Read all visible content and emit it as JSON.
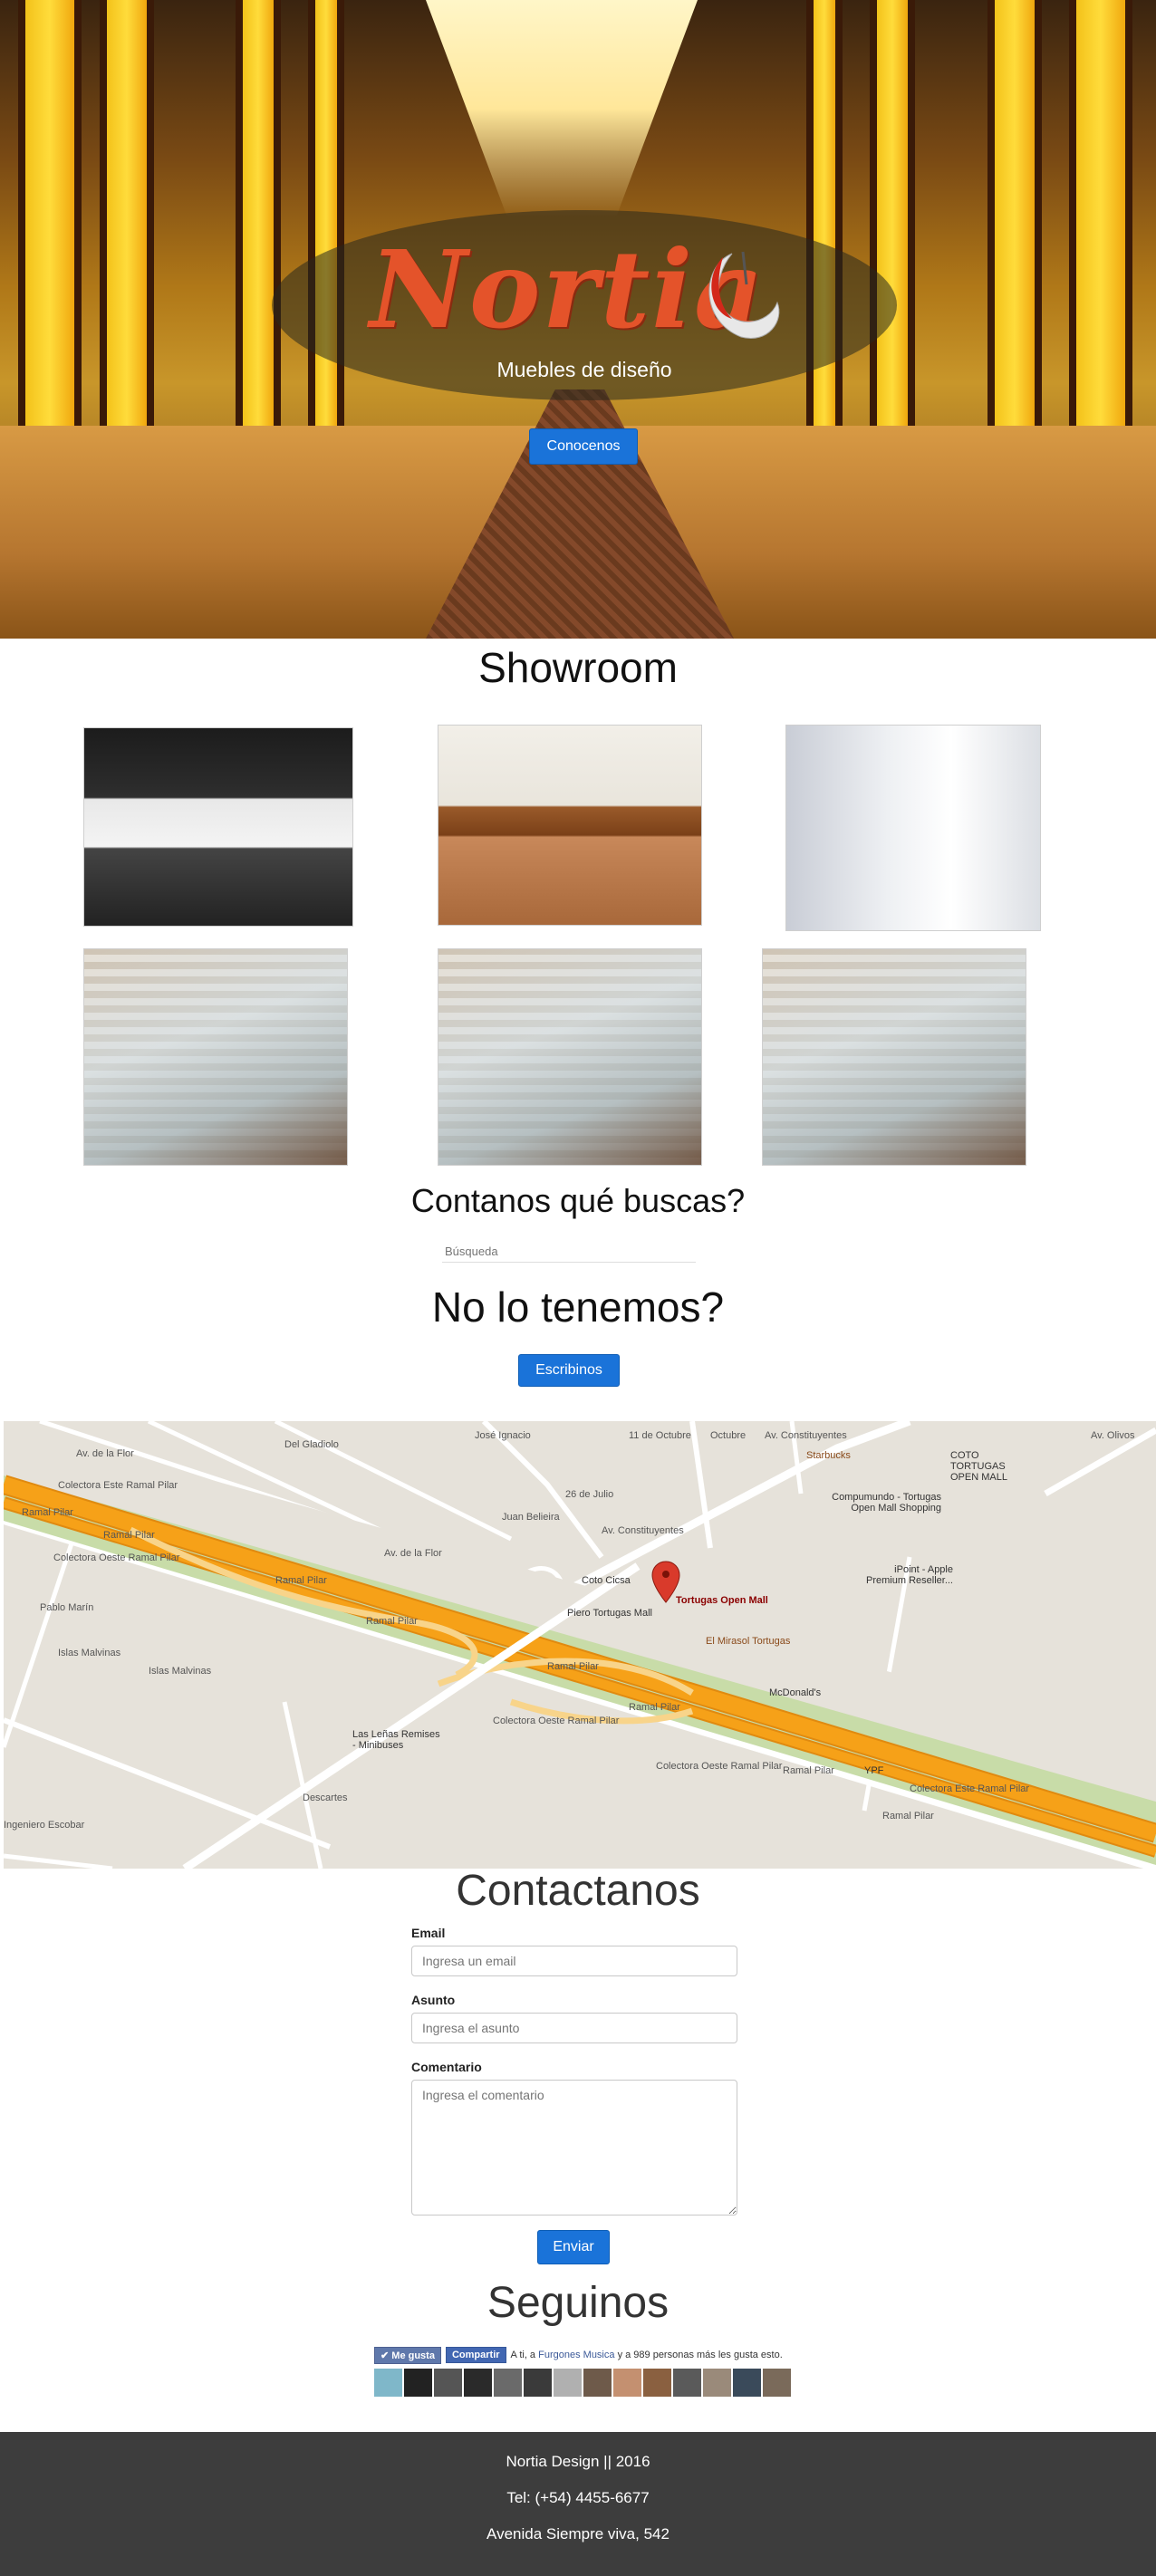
{
  "hero": {
    "brand": "Nortia",
    "tagline": "Muebles de diseño",
    "cta_label": "Conocenos"
  },
  "showroom": {
    "title": "Showroom",
    "photos": [
      "sala-moderna",
      "mesa-consola",
      "escritorio-blanco",
      "comedor-vidrio",
      "comedor-vidrio",
      "comedor-vidrio"
    ]
  },
  "search": {
    "title": "Contanos qué buscas?",
    "placeholder": "Búsqueda"
  },
  "not_found": {
    "title": "No lo tenemos?",
    "button_label": "Escribinos"
  },
  "map": {
    "marker_label": "Tortugas Open Mall",
    "labels": {
      "ramal_pilar": "Ramal Pilar",
      "colectora_este": "Colectora Este Ramal Pilar",
      "colectora_oeste": "Colectora Oeste Ramal Pilar",
      "av_flor": "Av. de la Flor",
      "del_gladiolo": "Del Gladiolo",
      "jose_ignacio": "José Ignacio",
      "once_octubre": "11 de Octubre",
      "octubre": "Octubre",
      "av_constituyentes": "Av. Constituyentes",
      "julio": "26 de Julio",
      "juan_belieira": "Juan Belieira",
      "islas_malvinas": "Islas Malvinas",
      "pablo_marin": "Pablo Marín",
      "descartes": "Descartes",
      "escobar": "Ingeniero Escobar",
      "av_olivos": "Av. Olivos",
      "starbucks": "Starbucks",
      "coto": "COTO TORTUGAS OPEN MALL",
      "compumundo": "Compumundo - Tortugas Open Mall Shopping",
      "ipoint": "iPoint - Apple Premium Reseller...",
      "coto_cicsa": "Coto Cicsa",
      "piero": "Piero Tortugas Mall",
      "mirasol": "El Mirasol Tortugas",
      "mcdonalds": "McDonald's",
      "ypf": "YPF",
      "las_lenas": "Las Leñas Remises - Minibuses"
    },
    "colors": {
      "highway": "#f6a118",
      "highway_border": "#e08a10",
      "green": "#c8dca8",
      "marker": "#d93a2b"
    }
  },
  "contact": {
    "title": "Contactanos",
    "email_label": "Email",
    "email_placeholder": "Ingresa un email",
    "subject_label": "Asunto",
    "subject_placeholder": "Ingresa el asunto",
    "comment_label": "Comentario",
    "comment_placeholder": "Ingresa el comentario",
    "submit_label": "Enviar"
  },
  "social": {
    "title": "Seguinos",
    "like_label": "Me gusta",
    "share_label": "Compartir",
    "text_pre": "A ti, a",
    "page_link": "Furgones Musica",
    "text_post": "y a 989 personas más les gusta esto.",
    "face_colors": [
      "#7fb7c9",
      "#222222",
      "#555555",
      "#2a2a2a",
      "#6a6a6a",
      "#3a3a3a",
      "#b0b0b0",
      "#6e5a4a",
      "#c49070",
      "#8a6040",
      "#5a5a5a",
      "#9a8a7a",
      "#3a4a5a",
      "#7a6a5a"
    ]
  },
  "footer": {
    "line1": "Nortia Design || 2016",
    "line2": "Tel: (+54) 4455-6677",
    "line3": "Avenida Siempre viva, 542"
  },
  "colors": {
    "accent": "#1a73d9",
    "footer_bg": "#3d3d3d",
    "logo": "#e4532a"
  }
}
